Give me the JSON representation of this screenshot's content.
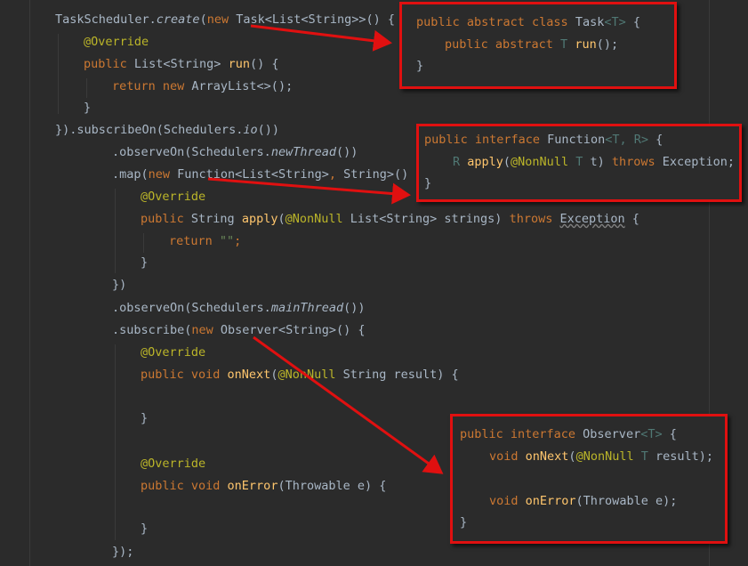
{
  "code": {
    "l1": {
      "a": "TaskScheduler.",
      "b": "create",
      "c": "(",
      "d": "new ",
      "e": "Task<List<String>>() {"
    },
    "l2": {
      "a": "@Override"
    },
    "l3": {
      "a": "public ",
      "b": "List<String> ",
      "c": "run",
      "d": "() {"
    },
    "l4": {
      "a": "return new ",
      "b": "ArrayList<>();"
    },
    "l5": {
      "a": "}"
    },
    "l6": {
      "a": "}).subscribeOn(Schedulers.",
      "b": "io",
      "c": "())"
    },
    "l7": {
      "a": ".observeOn(Schedulers.",
      "b": "newThread",
      "c": "())"
    },
    "l8": {
      "a": ".map(",
      "b": "new ",
      "c": "Function<List<String>",
      "d": ", ",
      "e": "String>() {"
    },
    "l9": {
      "a": "@Override"
    },
    "l10": {
      "a": "public ",
      "b": "String ",
      "c": "apply",
      "d": "(",
      "e": "@NonNull ",
      "f": "List<String> strings) ",
      "g": "throws ",
      "h": "Exception",
      "i": " {"
    },
    "l11": {
      "a": "return ",
      "b": "\"\"",
      "c": ";"
    },
    "l12": {
      "a": "}"
    },
    "l13": {
      "a": "})"
    },
    "l14": {
      "a": ".observeOn(Schedulers.",
      "b": "mainThread",
      "c": "())"
    },
    "l15": {
      "a": ".subscribe(",
      "b": "new ",
      "c": "Observer<String>() {"
    },
    "l16": {
      "a": "@Override"
    },
    "l17": {
      "a": "public void ",
      "b": "onNext",
      "c": "(",
      "d": "@NonNull ",
      "e": "String result) {"
    },
    "l18": {
      "a": "}"
    },
    "l19": {
      "a": "@Override"
    },
    "l20": {
      "a": "public void ",
      "b": "onError",
      "c": "(Throwable e) {"
    },
    "l21": {
      "a": "}"
    },
    "l22": {
      "a": "});"
    }
  },
  "callouts": {
    "task": {
      "l1": {
        "a": "public abstract class ",
        "b": "Task",
        "c": "<T>",
        "d": " {"
      },
      "l2": {
        "a": "public abstract ",
        "b": "T ",
        "c": "run",
        "d": "();"
      },
      "l3": {
        "a": "}"
      }
    },
    "function": {
      "l1": {
        "a": "public interface ",
        "b": "Function",
        "c": "<T, R>",
        "d": " {"
      },
      "l2": {
        "a": "R ",
        "b": "apply",
        "c": "(",
        "d": "@NonNull ",
        "e": "T ",
        "f": "t) ",
        "g": "throws ",
        "h": "Exception;"
      },
      "l3": {
        "a": "}"
      }
    },
    "observer": {
      "l1": {
        "a": "public interface ",
        "b": "Observer",
        "c": "<T>",
        "d": " {"
      },
      "l2": {
        "a": "void ",
        "b": "onNext",
        "c": "(",
        "d": "@NonNull ",
        "e": "T ",
        "f": "result);"
      },
      "l3": {
        "a": "void ",
        "b": "onError",
        "c": "(Throwable e);"
      },
      "l4": {
        "a": "}"
      }
    }
  },
  "colors": {
    "background": "#2b2b2b",
    "annotation": "#e01010",
    "keyword": "#cc7832",
    "method": "#ffc66d",
    "annotation_kw": "#bbb529",
    "text": "#a9b7c6"
  }
}
